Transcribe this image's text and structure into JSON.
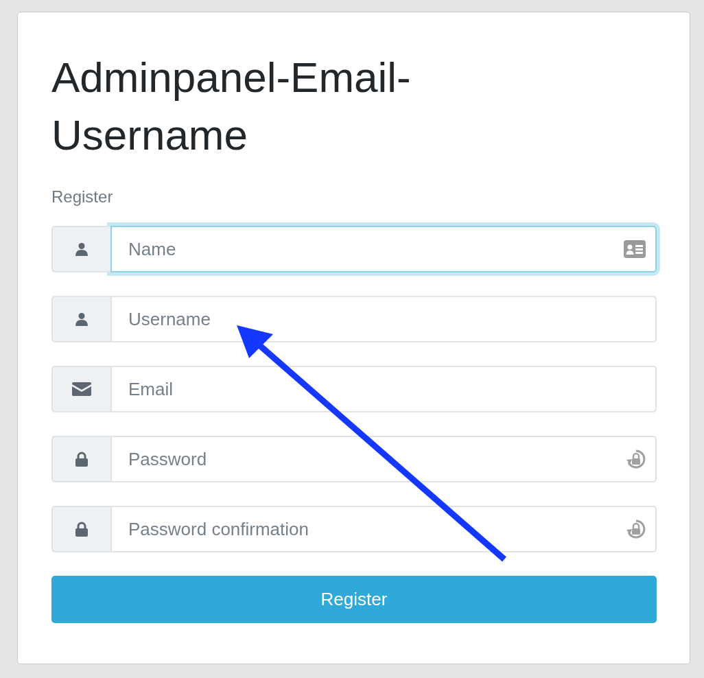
{
  "card": {
    "title": "Adminpanel-Email-Username",
    "subtitle": "Register"
  },
  "fields": [
    {
      "kind": "name",
      "placeholder": "Name",
      "focused": true
    },
    {
      "kind": "username",
      "placeholder": "Username",
      "focused": false
    },
    {
      "kind": "email",
      "placeholder": "Email",
      "focused": false
    },
    {
      "kind": "password",
      "placeholder": "Password",
      "focused": false
    },
    {
      "kind": "password",
      "placeholder": "Password confirmation",
      "focused": false
    }
  ],
  "submit": {
    "label": "Register"
  },
  "annotations": [
    {
      "kind": "arrow"
    }
  ]
}
